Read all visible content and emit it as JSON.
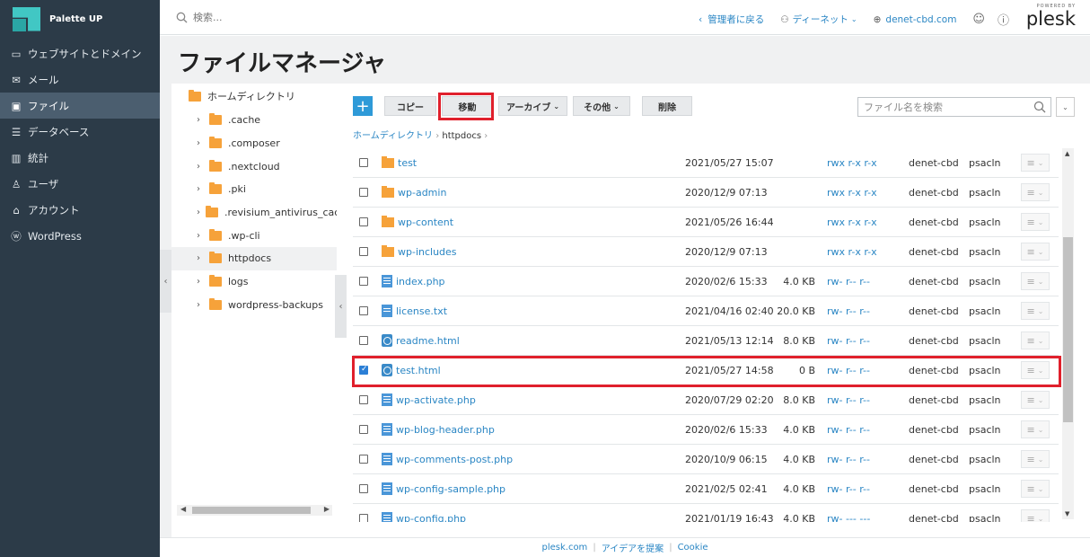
{
  "brand": {
    "name": "Palette UP"
  },
  "sidebar": {
    "items": [
      {
        "label": "ウェブサイトとドメイン",
        "icon": "monitor-icon"
      },
      {
        "label": "メール",
        "icon": "mail-icon"
      },
      {
        "label": "ファイル",
        "icon": "folder-icon",
        "active": true
      },
      {
        "label": "データベース",
        "icon": "database-icon"
      },
      {
        "label": "統計",
        "icon": "stats-icon"
      },
      {
        "label": "ユーザ",
        "icon": "user-icon"
      },
      {
        "label": "アカウント",
        "icon": "account-icon"
      },
      {
        "label": "WordPress",
        "icon": "wordpress-icon"
      }
    ]
  },
  "header": {
    "search_placeholder": "検索...",
    "back_to_admin": "管理者に戻る",
    "user": "ディーネット",
    "domain": "denet-cbd.com",
    "powered_by": "POWERED BY",
    "plesk": "plesk"
  },
  "page": {
    "title": "ファイルマネージャ"
  },
  "tree": {
    "root": "ホームディレクトリ",
    "items": [
      ".cache",
      ".composer",
      ".nextcloud",
      ".pki",
      ".revisium_antivirus_cache",
      ".wp-cli",
      "httpdocs",
      "logs",
      "wordpress-backups"
    ],
    "selected": "httpdocs"
  },
  "toolbar": {
    "add": "+",
    "copy": "コピー",
    "move": "移動",
    "archive": "アーカイブ",
    "other": "その他",
    "delete": "削除",
    "file_search_placeholder": "ファイル名を検索"
  },
  "breadcrumb": {
    "home": "ホームディレクトリ",
    "current": "httpdocs"
  },
  "files": [
    {
      "name": "test",
      "type": "folder",
      "date": "2021/05/27 15:07",
      "size": "",
      "perm": "rwx r-x r-x",
      "owner": "denet-cbd",
      "group": "psacln",
      "checked": false
    },
    {
      "name": "wp-admin",
      "type": "folder",
      "date": "2020/12/9 07:13",
      "size": "",
      "perm": "rwx r-x r-x",
      "owner": "denet-cbd",
      "group": "psacln",
      "checked": false
    },
    {
      "name": "wp-content",
      "type": "folder",
      "date": "2021/05/26 16:44",
      "size": "",
      "perm": "rwx r-x r-x",
      "owner": "denet-cbd",
      "group": "psacln",
      "checked": false
    },
    {
      "name": "wp-includes",
      "type": "folder",
      "date": "2020/12/9 07:13",
      "size": "",
      "perm": "rwx r-x r-x",
      "owner": "denet-cbd",
      "group": "psacln",
      "checked": false
    },
    {
      "name": "index.php",
      "type": "php",
      "date": "2020/02/6 15:33",
      "size": "4.0 KB",
      "perm": "rw- r-- r--",
      "owner": "denet-cbd",
      "group": "psacln",
      "checked": false
    },
    {
      "name": "license.txt",
      "type": "txt",
      "date": "2021/04/16 02:40",
      "size": "20.0 KB",
      "perm": "rw- r-- r--",
      "owner": "denet-cbd",
      "group": "psacln",
      "checked": false
    },
    {
      "name": "readme.html",
      "type": "html",
      "date": "2021/05/13 12:14",
      "size": "8.0 KB",
      "perm": "rw- r-- r--",
      "owner": "denet-cbd",
      "group": "psacln",
      "checked": false
    },
    {
      "name": "test.html",
      "type": "html",
      "date": "2021/05/27 14:58",
      "size": "0 B",
      "perm": "rw- r-- r--",
      "owner": "denet-cbd",
      "group": "psacln",
      "checked": true
    },
    {
      "name": "wp-activate.php",
      "type": "php",
      "date": "2020/07/29 02:20",
      "size": "8.0 KB",
      "perm": "rw- r-- r--",
      "owner": "denet-cbd",
      "group": "psacln",
      "checked": false
    },
    {
      "name": "wp-blog-header.php",
      "type": "php",
      "date": "2020/02/6 15:33",
      "size": "4.0 KB",
      "perm": "rw- r-- r--",
      "owner": "denet-cbd",
      "group": "psacln",
      "checked": false
    },
    {
      "name": "wp-comments-post.php",
      "type": "php",
      "date": "2020/10/9 06:15",
      "size": "4.0 KB",
      "perm": "rw- r-- r--",
      "owner": "denet-cbd",
      "group": "psacln",
      "checked": false
    },
    {
      "name": "wp-config-sample.php",
      "type": "php",
      "date": "2021/02/5 02:41",
      "size": "4.0 KB",
      "perm": "rw- r-- r--",
      "owner": "denet-cbd",
      "group": "psacln",
      "checked": false
    },
    {
      "name": "wp-config.php",
      "type": "php",
      "date": "2021/01/19 16:43",
      "size": "4.0 KB",
      "perm": "rw- --- ---",
      "owner": "denet-cbd",
      "group": "psacln",
      "checked": false
    }
  ],
  "footer": {
    "links": [
      "plesk.com",
      "アイデアを提案",
      "Cookie"
    ]
  }
}
